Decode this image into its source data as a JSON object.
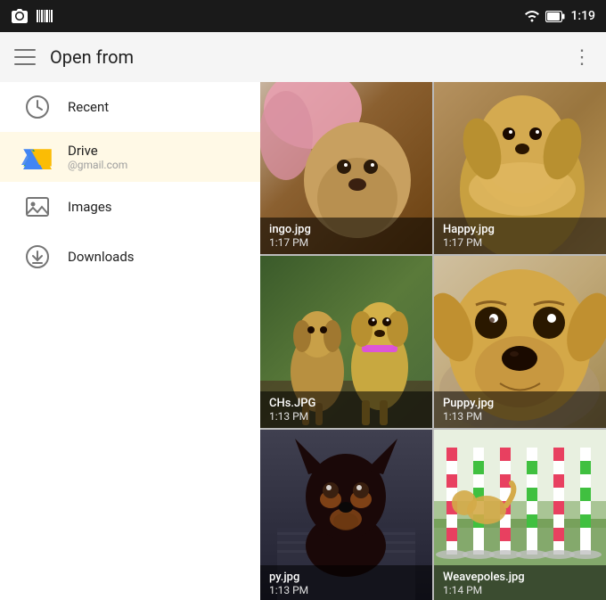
{
  "statusBar": {
    "time": "1:19",
    "icons": {
      "wifi": "wifi-icon",
      "battery": "battery-icon",
      "camera": "camera-icon",
      "barcode": "barcode-icon"
    }
  },
  "toolbar": {
    "hamburgerLabel": "☰",
    "title": "Open from",
    "menuLabel": "⋮"
  },
  "sidebar": {
    "items": [
      {
        "id": "recent",
        "label": "Recent",
        "icon": "clock-icon",
        "sub": ""
      },
      {
        "id": "drive",
        "label": "Drive",
        "icon": "drive-icon",
        "sub": "@gmail.com"
      },
      {
        "id": "images",
        "label": "Images",
        "icon": "images-icon",
        "sub": ""
      },
      {
        "id": "downloads",
        "label": "Downloads",
        "icon": "downloads-icon",
        "sub": ""
      }
    ]
  },
  "imageGrid": {
    "images": [
      {
        "filename": "ingo.jpg",
        "time": "1:17 PM",
        "style": "cell-1"
      },
      {
        "filename": "Happy.jpg",
        "time": "1:17 PM",
        "style": "cell-2"
      },
      {
        "filename": "CHs.JPG",
        "time": "1:13 PM",
        "style": "dog-img-3"
      },
      {
        "filename": "Puppy.jpg",
        "time": "1:13 PM",
        "style": "dog-img-4"
      },
      {
        "filename": "py.jpg",
        "time": "1:13 PM",
        "style": "dog-img-5"
      },
      {
        "filename": "Weavepoles.jpg",
        "time": "1:14 PM",
        "style": "dog-img-6"
      }
    ]
  }
}
